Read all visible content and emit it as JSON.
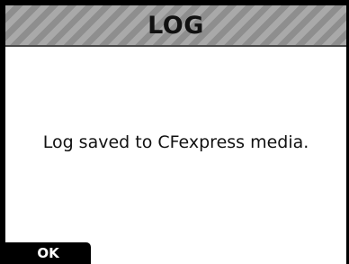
{
  "dialog": {
    "title": "LOG",
    "message": "Log saved to CFexpress media.",
    "ok_label": "OK"
  },
  "colors": {
    "title_bar": "#9a9a9a",
    "background": "#ffffff",
    "frame": "#000000",
    "button_background": "#000000",
    "button_text": "#ffffff"
  }
}
